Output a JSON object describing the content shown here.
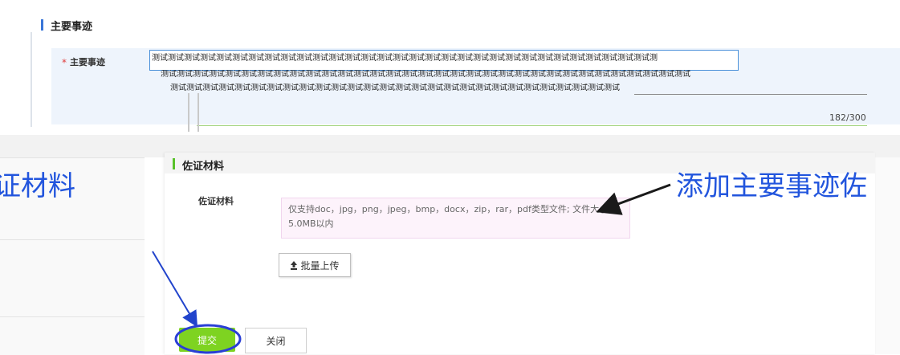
{
  "main_deeds": {
    "section_title": "主要事迹",
    "field_label": "主要事迹",
    "required_mark": "*",
    "text_line1": "测试测试测试测试测试测试测试测试测试测试测试测试测试测试测试测试测试测试测试测试测试测试测试测试测试测试测试测试测试测试测试测",
    "text_line2": "测试测试测试测试测试测试测试测试测试测试测试测试测试测试测试测试测试测试测试测试测试测试测试测试测试测试测试测试测试测试测试测试测试",
    "text_line3": "测试测试测试测试测试测试测试测试测试测试测试测试测试测试测试测试测试测试测试测试测试测试测试测试测试测试测试测试",
    "char_counter": "182/300"
  },
  "evidence": {
    "section_title": "佐证材料",
    "field_label": "佐证材料",
    "upload_tip": "仅支持doc，jpg，png，jpeg，bmp，docx，zip，rar，pdf类型文件; 文件大小",
    "upload_tip_line2": "5.0MB以内",
    "batch_upload_label": "批量上传",
    "upload_icon": "upload-icon"
  },
  "actions": {
    "submit_label": "提交",
    "close_label": "关闭"
  },
  "annotations": {
    "left_text": "证材料",
    "right_text": "添加主要事迹佐",
    "color": "#2255dd"
  },
  "colors": {
    "accent_blue": "#3a76d8",
    "accent_green": "#58c12a",
    "submit_green": "#7ed321",
    "required_red": "#e03b3b"
  }
}
